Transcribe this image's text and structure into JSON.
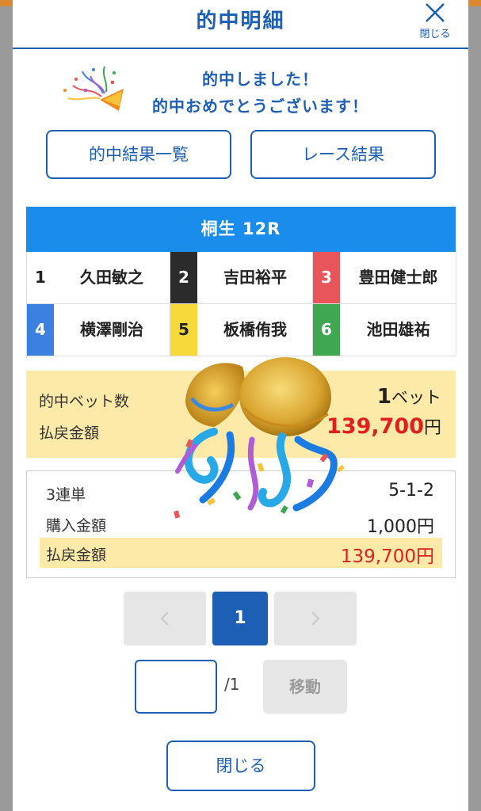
{
  "modal": {
    "title": "的中明細",
    "close_label": "閉じる"
  },
  "congrats": {
    "line1": "的中しました！",
    "line2": "的中おめでとうございます！"
  },
  "buttons": {
    "hit_list": "的中結果一覧",
    "race_result": "レース結果",
    "close": "閉じる"
  },
  "race": {
    "title": "桐生 12R",
    "racers": [
      {
        "num": "1",
        "name": "久田敏之",
        "bg": "#ffffff",
        "fg": "#222222"
      },
      {
        "num": "2",
        "name": "吉田裕平",
        "bg": "#2b2b2b",
        "fg": "#ffffff"
      },
      {
        "num": "3",
        "name": "豊田健士郎",
        "bg": "#e8555a",
        "fg": "#ffffff"
      },
      {
        "num": "4",
        "name": "横澤剛治",
        "bg": "#3b82e0",
        "fg": "#ffffff"
      },
      {
        "num": "5",
        "name": "板橋侑我",
        "bg": "#f6d93b",
        "fg": "#222222"
      },
      {
        "num": "6",
        "name": "池田雄祐",
        "bg": "#3fa651",
        "fg": "#ffffff"
      }
    ]
  },
  "summary": {
    "bet_count_label": "的中ベット数",
    "bet_count_value": "1",
    "bet_count_unit": "ベット",
    "payout_label": "払戻金額",
    "payout_value": "139,700",
    "payout_unit": "円"
  },
  "detail": {
    "bet_type": "3連単",
    "combination": "5-1-2",
    "purchase_label": "購入金額",
    "purchase_value": "1,000円",
    "payout_label": "払戻金額",
    "payout_value": "139,700円"
  },
  "pagination": {
    "current": "1",
    "prev_icon": "chevron-left-icon",
    "next_icon": "chevron-right-icon"
  },
  "jump": {
    "input_value": "",
    "total": "/1",
    "button_label": "移動"
  },
  "colors": {
    "primary": "#1c5fb5",
    "race_header": "#1a8ceb",
    "highlight": "#fdeaa8",
    "payout_red": "#e02020"
  }
}
